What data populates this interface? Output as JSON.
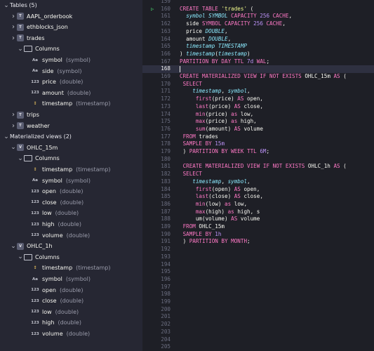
{
  "sidebar": {
    "tables_header": "Tables (5)",
    "tables": [
      {
        "name": "AAPL_orderbook"
      },
      {
        "name": "ethblocks_json"
      },
      {
        "name": "trades"
      }
    ],
    "trades_columns_label": "Columns",
    "trades_columns": [
      {
        "badge": "Aa",
        "name": "symbol",
        "type": "(symbol)"
      },
      {
        "badge": "Aa",
        "name": "side",
        "type": "(symbol)"
      },
      {
        "badge": "123",
        "name": "price",
        "type": "(double)"
      },
      {
        "badge": "123",
        "name": "amount",
        "type": "(double)"
      },
      {
        "badge": "↕",
        "name": "timestamp",
        "type": "(timestamp)"
      }
    ],
    "tables_more": [
      {
        "name": "trips"
      },
      {
        "name": "weather"
      }
    ],
    "mv_header": "Materialized views (2)",
    "mv1": {
      "name": "OHLC_15m",
      "columns_label": "Columns",
      "columns": [
        {
          "badge": "↕",
          "name": "timestamp",
          "type": "(timestamp)"
        },
        {
          "badge": "Aa",
          "name": "symbol",
          "type": "(symbol)"
        },
        {
          "badge": "123",
          "name": "open",
          "type": "(double)"
        },
        {
          "badge": "123",
          "name": "close",
          "type": "(double)"
        },
        {
          "badge": "123",
          "name": "low",
          "type": "(double)"
        },
        {
          "badge": "123",
          "name": "high",
          "type": "(double)"
        },
        {
          "badge": "123",
          "name": "volume",
          "type": "(double)"
        }
      ]
    },
    "mv2": {
      "name": "OHLC_1h",
      "columns_label": "Columns",
      "columns": [
        {
          "badge": "↕",
          "name": "timestamp",
          "type": "(timestamp)"
        },
        {
          "badge": "Aa",
          "name": "symbol",
          "type": "(symbol)"
        },
        {
          "badge": "123",
          "name": "open",
          "type": "(double)"
        },
        {
          "badge": "123",
          "name": "close",
          "type": "(double)"
        },
        {
          "badge": "123",
          "name": "low",
          "type": "(double)"
        },
        {
          "badge": "123",
          "name": "high",
          "type": "(double)"
        },
        {
          "badge": "123",
          "name": "volume",
          "type": "(double)"
        }
      ]
    }
  },
  "editor": {
    "first_line_number": 159,
    "active_line": 168,
    "run_line": 160,
    "lines": [
      [],
      [
        [
          "kw",
          "CREATE TABLE "
        ],
        [
          "str",
          "'trades'"
        ],
        [
          "wh",
          " ("
        ]
      ],
      [
        [
          "ty",
          "  symbol SYMBOL"
        ],
        [
          "kw",
          " CAPACITY "
        ],
        [
          "num",
          "256"
        ],
        [
          "kw",
          " CACHE"
        ],
        [
          "wh",
          ","
        ]
      ],
      [
        [
          "wh",
          "  side "
        ],
        [
          "kw",
          "SYMBOL CAPACITY "
        ],
        [
          "num",
          "256"
        ],
        [
          "kw",
          " CACHE"
        ],
        [
          "wh",
          ","
        ]
      ],
      [
        [
          "wh",
          "  price "
        ],
        [
          "ty",
          "DOUBLE"
        ],
        [
          "wh",
          ","
        ]
      ],
      [
        [
          "wh",
          "  amount "
        ],
        [
          "ty",
          "DOUBLE"
        ],
        [
          "wh",
          ","
        ]
      ],
      [
        [
          "ty",
          "  timestamp TIMESTAMP"
        ]
      ],
      [
        [
          "wh",
          ") "
        ],
        [
          "fn",
          "timestamp"
        ],
        [
          "wh",
          "("
        ],
        [
          "fn",
          "timestamp"
        ],
        [
          "wh",
          ")"
        ]
      ],
      [
        [
          "kw",
          "PARTITION BY DAY TTL "
        ],
        [
          "num",
          "7d"
        ],
        [
          "kw",
          " WAL"
        ],
        [
          "wh",
          ";"
        ]
      ],
      [],
      [
        [
          "kw",
          "CREATE MATERIALIZED VIEW IF NOT EXISTS "
        ],
        [
          "wh",
          "OHLC_15m "
        ],
        [
          "kw",
          "AS"
        ],
        [
          "wh",
          " ("
        ]
      ],
      [
        [
          "kw",
          " SELECT"
        ]
      ],
      [
        [
          "fn",
          "    timestamp"
        ],
        [
          "wh",
          ", "
        ],
        [
          "fn",
          "symbol"
        ],
        [
          "wh",
          ","
        ]
      ],
      [
        [
          "kw",
          "     first"
        ],
        [
          "wh",
          "(price) "
        ],
        [
          "kw",
          "AS"
        ],
        [
          "wh",
          " open,"
        ]
      ],
      [
        [
          "kw",
          "     last"
        ],
        [
          "wh",
          "(price) "
        ],
        [
          "kw",
          "AS"
        ],
        [
          "wh",
          " close,"
        ]
      ],
      [
        [
          "kw",
          "     min"
        ],
        [
          "wh",
          "(price) "
        ],
        [
          "kw",
          "as"
        ],
        [
          "wh",
          " low,"
        ]
      ],
      [
        [
          "kw",
          "     max"
        ],
        [
          "wh",
          "(price) "
        ],
        [
          "kw",
          "as"
        ],
        [
          "wh",
          " high,"
        ]
      ],
      [
        [
          "kw",
          "     sum"
        ],
        [
          "wh",
          "(amount) "
        ],
        [
          "kw",
          "AS"
        ],
        [
          "wh",
          " volume"
        ]
      ],
      [
        [
          "kw",
          " FROM"
        ],
        [
          "wh",
          " trades"
        ]
      ],
      [
        [
          "kw",
          " SAMPLE BY "
        ],
        [
          "num",
          "15m"
        ]
      ],
      [
        [
          "wh",
          " ) "
        ],
        [
          "kw",
          "PARTITION BY WEEK TTL "
        ],
        [
          "num",
          "6M"
        ],
        [
          "wh",
          ";"
        ]
      ],
      [],
      [
        [
          "kw",
          " CREATE MATERIALIZED VIEW IF NOT EXISTS "
        ],
        [
          "wh",
          "OHLC_1h "
        ],
        [
          "kw",
          "AS"
        ],
        [
          "wh",
          " ("
        ]
      ],
      [
        [
          "kw",
          " SELECT"
        ]
      ],
      [
        [
          "fn",
          "    timestamp"
        ],
        [
          "wh",
          ", "
        ],
        [
          "fn",
          "symbol"
        ],
        [
          "wh",
          ","
        ]
      ],
      [
        [
          "kw",
          "     first"
        ],
        [
          "wh",
          "(open) "
        ],
        [
          "kw",
          "AS"
        ],
        [
          "wh",
          " open,"
        ]
      ],
      [
        [
          "kw",
          "     last"
        ],
        [
          "wh",
          "(close) "
        ],
        [
          "kw",
          "AS"
        ],
        [
          "wh",
          " close,"
        ]
      ],
      [
        [
          "kw",
          "     min"
        ],
        [
          "wh",
          "(low) "
        ],
        [
          "kw",
          "as"
        ],
        [
          "wh",
          " low,"
        ]
      ],
      [
        [
          "kw",
          "     max"
        ],
        [
          "wh",
          "(high) "
        ],
        [
          "kw",
          "as"
        ],
        [
          "wh",
          " high, s"
        ]
      ],
      [
        [
          "wh",
          "     um(volume) "
        ],
        [
          "kw",
          "AS"
        ],
        [
          "wh",
          " volume"
        ]
      ],
      [
        [
          "kw",
          " FROM"
        ],
        [
          "wh",
          " OHLC_15m"
        ]
      ],
      [
        [
          "kw",
          " SAMPLE BY "
        ],
        [
          "num",
          "1h"
        ]
      ],
      [
        [
          "wh",
          " ) "
        ],
        [
          "kw",
          "PARTITION BY MONTH"
        ],
        [
          "wh",
          ";"
        ]
      ],
      [],
      [],
      [],
      [],
      [],
      [],
      [],
      [],
      [],
      [],
      [],
      [],
      [],
      []
    ]
  }
}
